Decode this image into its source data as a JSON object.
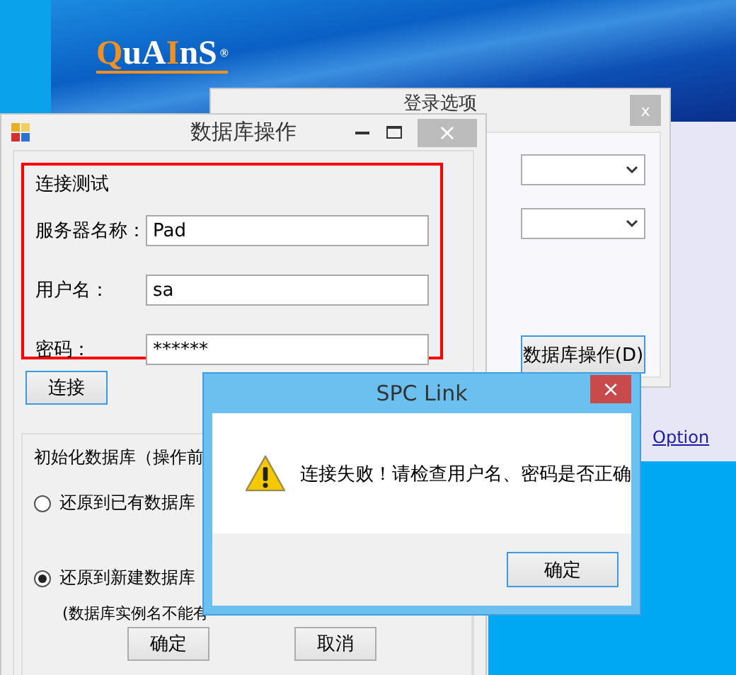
{
  "background_app": {
    "logo": [
      {
        "text": "Q",
        "color": "#f0901e"
      },
      {
        "text": "uA",
        "color": "#ffffff"
      },
      {
        "text": "I",
        "color": "#f0901e"
      },
      {
        "text": "nS",
        "color": "#ffffff"
      }
    ],
    "logo_mark": "®",
    "option_link": "Option"
  },
  "login_options_window": {
    "title": "登录选项",
    "close": "x",
    "button": "数据库操作(D)"
  },
  "db_window": {
    "title": "数据库操作",
    "close": "×",
    "connection_group": {
      "legend": "连接测试",
      "fields": [
        {
          "label": "服务器名称：",
          "value": "Pad"
        },
        {
          "label": "用户名：",
          "value": "sa"
        },
        {
          "label": "密码：",
          "value": "******"
        }
      ]
    },
    "connect_button": "连接",
    "init_group": {
      "legend": "初始化数据库（操作前",
      "options": [
        {
          "label": "还原到已有数据库",
          "selected": false
        },
        {
          "label": "还原到新建数据库",
          "selected": true
        }
      ],
      "note": "(数据库实例名不能有"
    },
    "buttons": [
      "确定",
      "取消"
    ]
  },
  "message_box": {
    "title": "SPC Link",
    "close": "×",
    "message": "连接失败！请检查用户名、密码是否正确",
    "button": "确定"
  }
}
